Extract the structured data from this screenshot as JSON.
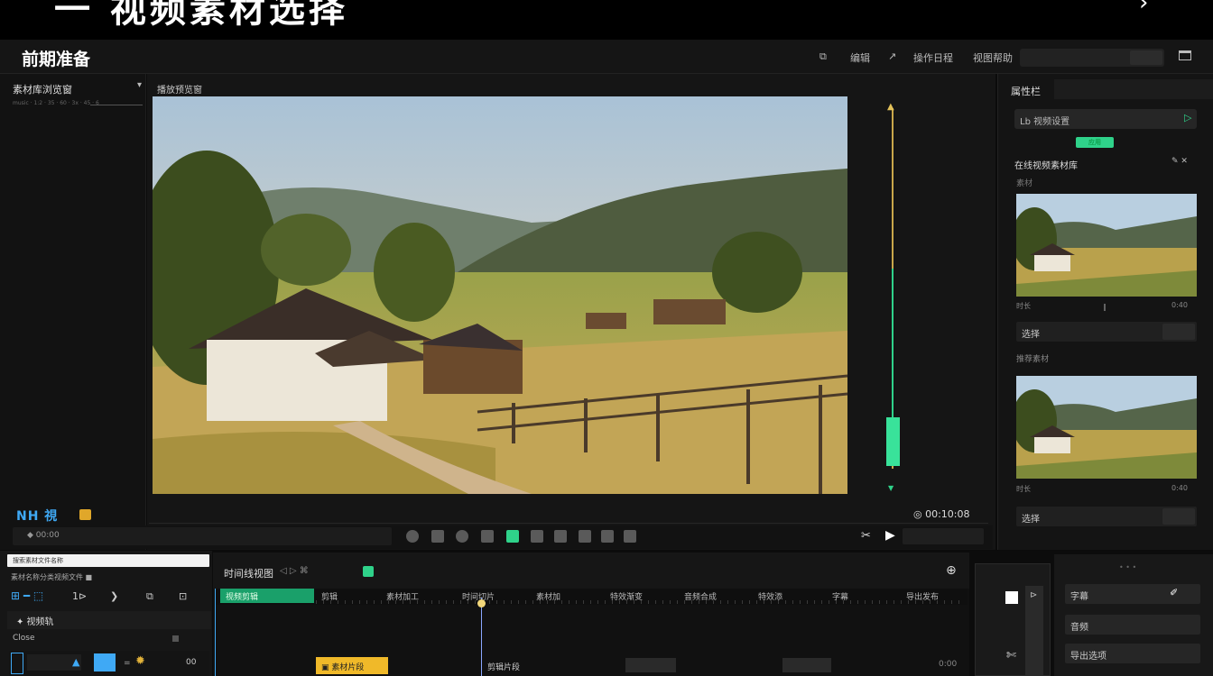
{
  "banner": {
    "text": "一 视频素材选择",
    "chevron": "›"
  },
  "app": {
    "title": "前期准备"
  },
  "titlebar": {
    "items": [
      "⧉",
      "编辑",
      "↗",
      "操作日程",
      "视图帮助"
    ],
    "search_placeholder": ""
  },
  "left_panel": {
    "title": "素材库浏览窗",
    "caret": "▾",
    "subtitle": "music · 1:2 · 35 · 60 · 3x · 45 · 6"
  },
  "viewer": {
    "label": "播放预览窗",
    "toolbar_left": "NH 視",
    "toolbar_right": "◎ 00:10:08"
  },
  "controls": {
    "left_text": "◆ 00:00",
    "play": "▶",
    "cut": "✂"
  },
  "right_panel": {
    "tab": "属性栏",
    "field_label": "Lb   视频设置",
    "field_play": "▷",
    "green_button": "应用",
    "section_title": "在线视频素材库",
    "section_icons": "✎ ✕",
    "sub1": "素材",
    "cap1_left": "时长",
    "cap1_mid": "‖",
    "cap1_right": "0:40",
    "row1": "选择",
    "sub2": "推荐素材",
    "cap2_left": "时长",
    "cap2_right": "0:40",
    "row2": "选择"
  },
  "timeline_left": {
    "input_text": "搜索素材文件名称",
    "sub": "素材名称分类视频文件 ■",
    "tools": [
      "⊞ ━ ⬚",
      "1⊳",
      "❯",
      "⧉",
      "⊡"
    ],
    "track": "✦  视频轨",
    "row2": "Close",
    "num": "00"
  },
  "timeline": {
    "title": "时间线视图",
    "ctrls": "◁  ▷  ⌘",
    "right_icon": "⊕",
    "ruler_green": "视频剪辑",
    "ruler_labels": [
      "剪辑",
      "素材加工",
      "时间切片",
      "素材加",
      "特效渐变",
      "音频合成",
      "特效添",
      "字幕",
      "导出发布"
    ],
    "clip_yellow": "▣ 素材片段",
    "clip_text": "剪辑片段",
    "clip_right": "0:00"
  },
  "bottom_right": {
    "dots": "• • •",
    "rows": [
      "字幕",
      "音频",
      "导出选项"
    ],
    "row1_icon": "✐",
    "mid_icon": "⊳",
    "mid_icon2": "✄"
  }
}
